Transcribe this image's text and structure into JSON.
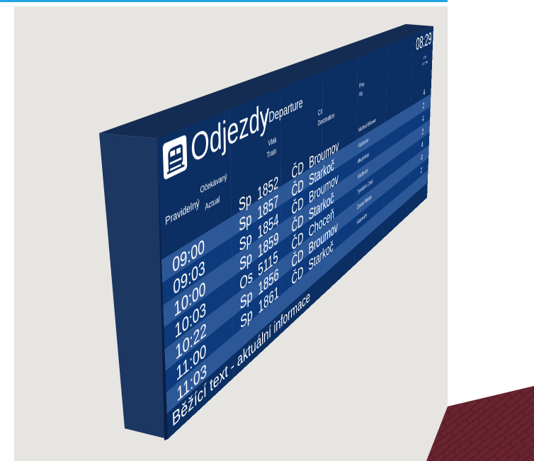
{
  "board": {
    "title": "Odjezdy",
    "title_en": "/ Departure",
    "clock": "08:29",
    "headers": {
      "scheduled": "Pravidelný",
      "expected": "Očekávaný",
      "actual": "Actual",
      "train_cs": "Vlak",
      "train_en": "Train",
      "dest_cs": "Cíl",
      "dest_en": "Destination",
      "via_cs": "Přes",
      "via_en": "Via",
      "platform_cs": "Kolej",
      "platform_en": "Platform"
    },
    "rows": [
      {
        "time": "09:00",
        "type": "Sp",
        "num": "1852",
        "carrier": "ČD",
        "dest": "Broumov",
        "via": "Náchod-Bělovec",
        "platform": "4"
      },
      {
        "time": "09:03",
        "type": "Sp",
        "num": "1857",
        "carrier": "ČD",
        "dest": "Starkoč",
        "via": "Václavice",
        "platform": "2"
      },
      {
        "time": "10:00",
        "type": "Sp",
        "num": "1854",
        "carrier": "ČD",
        "dest": "Broumov",
        "via": "Meziměstí",
        "platform": "4"
      },
      {
        "time": "10:03",
        "type": "Sp",
        "num": "1859",
        "carrier": "ČD",
        "dest": "Starkoč",
        "via": "Václavice",
        "platform": "2"
      },
      {
        "time": "10:22",
        "type": "Os",
        "num": "5115",
        "carrier": "ČD",
        "dest": "Choceň",
        "via": "Týniště n.Orlicí",
        "platform": "4"
      },
      {
        "time": "11:00",
        "type": "Sp",
        "num": "1856",
        "carrier": "ČD",
        "dest": "Broumov",
        "via": "Česká Metuje",
        "platform": "4"
      },
      {
        "time": "11:03",
        "type": "Sp",
        "num": "1861",
        "carrier": "ČD",
        "dest": "Starkoč",
        "via": "Václavice",
        "platform": "2"
      }
    ],
    "ticker": "Běžící text - aktuální informace"
  },
  "colors": {
    "board_face": "#0b2e63",
    "row_alt": "#2d5898",
    "board_side": "#1d3763",
    "wall": "#e6e5e1",
    "top_accent": "#1fa3e3",
    "floor_brick": "#5a1e28"
  },
  "icons": {
    "logo": "train-icon"
  }
}
